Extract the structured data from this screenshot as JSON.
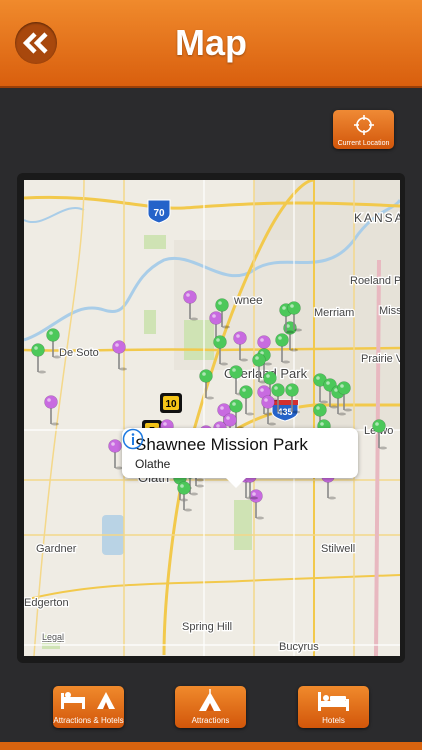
{
  "header": {
    "title": "Map",
    "back_icon": "double-chevron-left-icon"
  },
  "current_location": {
    "label": "Current Location",
    "icon": "crosshair-icon"
  },
  "map": {
    "labels": {
      "i70": "70",
      "kansas": "KANSA",
      "roeland": "Roeland Pa",
      "wnee": "wnee",
      "merriam": "Merriam",
      "miss": "Miss",
      "de_soto": "De Soto",
      "overland": "Overland Park",
      "prairie": "Prairie V",
      "us10": "10",
      "us7": "7",
      "i435": "435",
      "lenexa": "Le wo",
      "olathe": "Olath",
      "gardner": "Gardner",
      "stilwell": "Stilwell",
      "edgerton": "Edgerton",
      "spring_hill": "Spring Hill",
      "bucyrus": "Bucyrus",
      "legal": "Legal"
    }
  },
  "callout": {
    "title": "Shawnee Mission Park",
    "subtitle": "Olathe",
    "icon": "info-icon"
  },
  "tabs": [
    {
      "label": "Attractions & Hotels",
      "icon": "bed-and-tent-icon"
    },
    {
      "label": "Attractions",
      "icon": "tent-icon"
    },
    {
      "label": "Hotels",
      "icon": "bed-icon"
    }
  ],
  "colors": {
    "accent": "#e8741e",
    "pin_green": "#4cc85a",
    "pin_purple": "#c86be0"
  }
}
